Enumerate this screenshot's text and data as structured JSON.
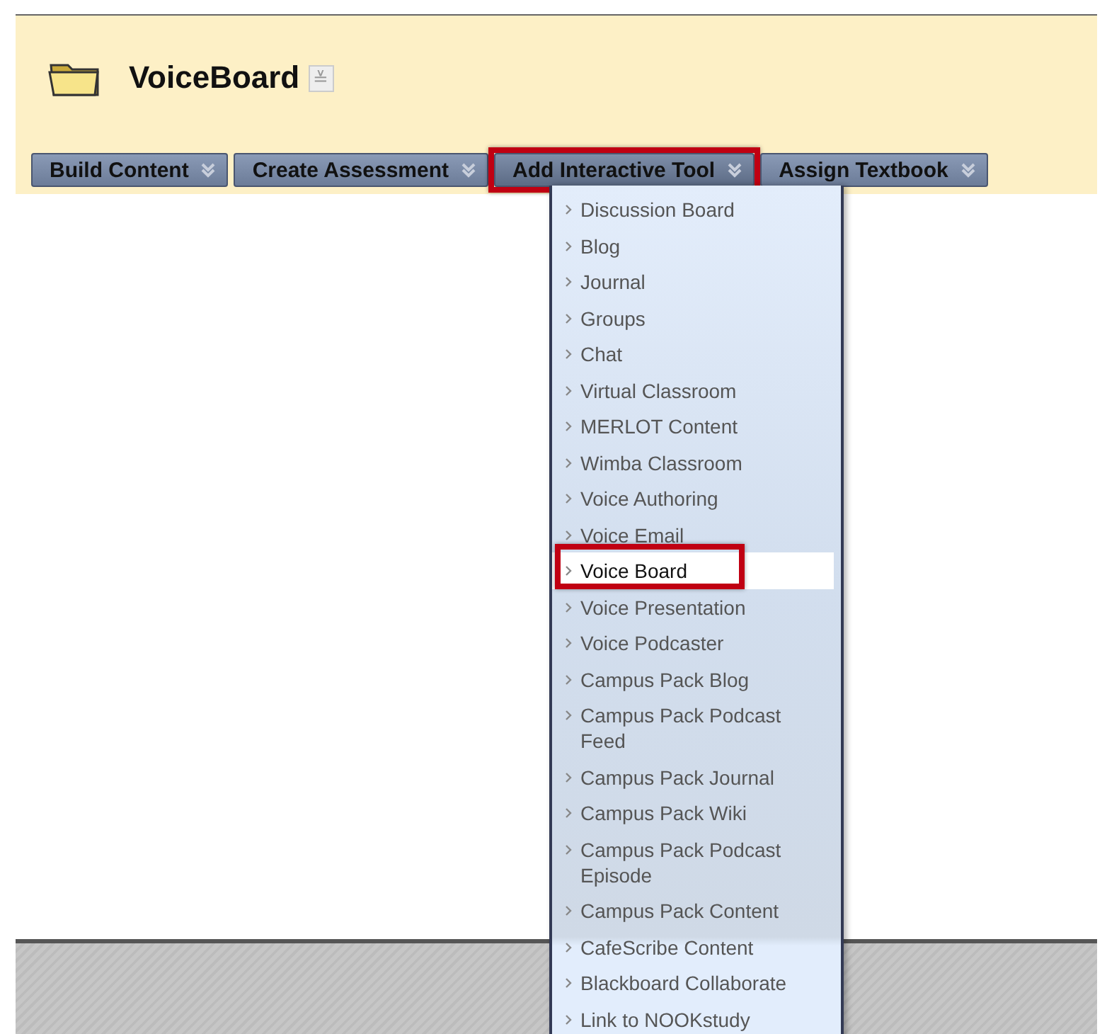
{
  "page": {
    "title": "VoiceBoard",
    "title_menu": "≚"
  },
  "toolbar": [
    {
      "label": "Build Content",
      "selected": false,
      "highlighted": false
    },
    {
      "label": "Create Assessment",
      "selected": false,
      "highlighted": false
    },
    {
      "label": "Add Interactive Tool",
      "selected": true,
      "highlighted": true
    },
    {
      "label": "Assign Textbook",
      "selected": false,
      "highlighted": false
    }
  ],
  "menu": {
    "items": [
      {
        "label": "Discussion Board",
        "selected": false,
        "highlighted": false
      },
      {
        "label": "Blog",
        "selected": false,
        "highlighted": false
      },
      {
        "label": "Journal",
        "selected": false,
        "highlighted": false
      },
      {
        "label": "Groups",
        "selected": false,
        "highlighted": false
      },
      {
        "label": "Chat",
        "selected": false,
        "highlighted": false
      },
      {
        "label": "Virtual Classroom",
        "selected": false,
        "highlighted": false
      },
      {
        "label": "MERLOT Content",
        "selected": false,
        "highlighted": false
      },
      {
        "label": "Wimba Classroom",
        "selected": false,
        "highlighted": false
      },
      {
        "label": "Voice Authoring",
        "selected": false,
        "highlighted": false
      },
      {
        "label": "Voice Email",
        "selected": false,
        "highlighted": false
      },
      {
        "label": "Voice Board",
        "selected": true,
        "highlighted": true
      },
      {
        "label": "Voice Presentation",
        "selected": false,
        "highlighted": false
      },
      {
        "label": "Voice Podcaster",
        "selected": false,
        "highlighted": false
      },
      {
        "label": "Campus Pack Blog",
        "selected": false,
        "highlighted": false
      },
      {
        "label": "Campus Pack Podcast Feed",
        "selected": false,
        "highlighted": false
      },
      {
        "label": "Campus Pack Journal",
        "selected": false,
        "highlighted": false
      },
      {
        "label": "Campus Pack Wiki",
        "selected": false,
        "highlighted": false
      },
      {
        "label": "Campus Pack Podcast Episode",
        "selected": false,
        "highlighted": false
      },
      {
        "label": "Campus Pack Content",
        "selected": false,
        "highlighted": false
      },
      {
        "label": "CafeScribe Content",
        "selected": false,
        "highlighted": false
      },
      {
        "label": "Blackboard Collaborate",
        "selected": false,
        "highlighted": false
      },
      {
        "label": "Link to NOOKstudy",
        "selected": false,
        "highlighted": false
      }
    ]
  }
}
